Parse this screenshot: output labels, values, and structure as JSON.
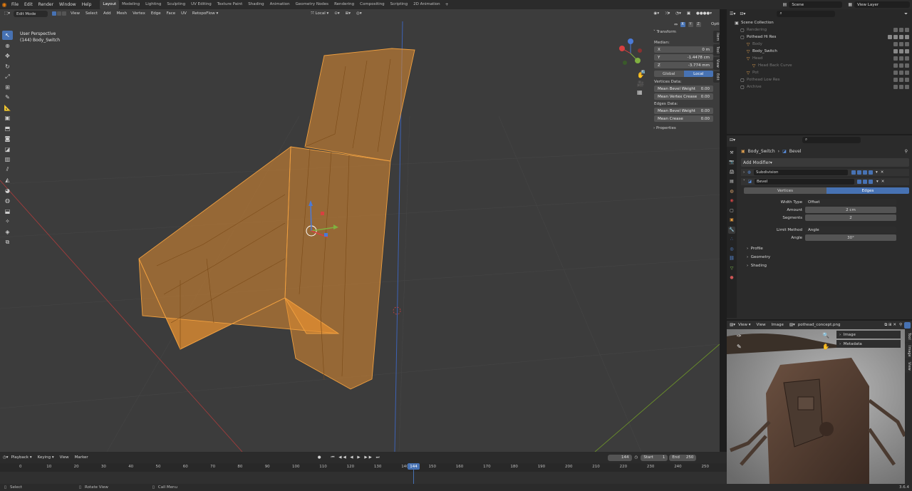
{
  "app": {
    "version": "3.6.4"
  },
  "menu": [
    "File",
    "Edit",
    "Render",
    "Window",
    "Help"
  ],
  "workspaces": [
    {
      "label": "Layout",
      "active": true
    },
    {
      "label": "Modeling"
    },
    {
      "label": "Lighting"
    },
    {
      "label": "Sculpting"
    },
    {
      "label": "UV Editing"
    },
    {
      "label": "Texture Paint"
    },
    {
      "label": "Shading"
    },
    {
      "label": "Animation"
    },
    {
      "label": "Geometry Nodes"
    },
    {
      "label": "Rendering"
    },
    {
      "label": "Compositing"
    },
    {
      "label": "Scripting"
    },
    {
      "label": "2D Animation"
    }
  ],
  "scene": {
    "name": "Scene",
    "view_layer": "View Layer"
  },
  "viewport": {
    "mode": "Edit Mode",
    "menus": [
      "View",
      "Select",
      "Add",
      "Mesh",
      "Vertex",
      "Edge",
      "Face",
      "UV"
    ],
    "addon_menu": "RetopoFlow",
    "orientation": "Local",
    "options": "Options",
    "info_line1": "User Perspective",
    "info_line2": "(144) Body_Switch",
    "gizmo_labels": {
      "x": "X",
      "y": "Y",
      "z": "Z"
    }
  },
  "npanel": {
    "header": "Transform",
    "median": "Median:",
    "coords": [
      {
        "k": "X",
        "v": "0 m"
      },
      {
        "k": "Y",
        "v": "-1.4478 cm"
      },
      {
        "k": "Z",
        "v": "-3.774 mm"
      }
    ],
    "space": [
      {
        "label": "Global"
      },
      {
        "label": "Local",
        "active": true
      }
    ],
    "vertices_data": "Vertices Data:",
    "vert_rows": [
      {
        "k": "Mean Bevel Weight",
        "v": "0.00"
      },
      {
        "k": "Mean Vertex Crease",
        "v": "0.00"
      }
    ],
    "edges_data": "Edges Data:",
    "edge_rows": [
      {
        "k": "Mean Bevel Weight",
        "v": "0.00"
      },
      {
        "k": "Mean Crease",
        "v": "0.00"
      }
    ],
    "properties": "Properties",
    "tabs": [
      "Item",
      "Tool",
      "View",
      "Edit"
    ]
  },
  "outliner": {
    "rows": [
      {
        "label": "Scene Collection",
        "indent": 0,
        "icon": "▣",
        "dim": false
      },
      {
        "label": "Rendering",
        "indent": 1,
        "icon": "▢",
        "dim": true
      },
      {
        "label": "Pothead Hi Res",
        "indent": 1,
        "icon": "▢",
        "dim": false,
        "check": true
      },
      {
        "label": "Body",
        "indent": 2,
        "icon": "▽",
        "dim": true
      },
      {
        "label": "Body_Switch",
        "indent": 2,
        "icon": "▽",
        "dim": false
      },
      {
        "label": "Head",
        "indent": 2,
        "icon": "▽",
        "dim": true
      },
      {
        "label": "Head Back Curve",
        "indent": 3,
        "icon": "▽",
        "dim": true
      },
      {
        "label": "Pot",
        "indent": 2,
        "icon": "▽",
        "dim": true
      },
      {
        "label": "Pothead Low Res",
        "indent": 1,
        "icon": "▢",
        "dim": true
      },
      {
        "label": "Archive",
        "indent": 1,
        "icon": "▢",
        "dim": true
      }
    ]
  },
  "properties": {
    "breadcrumb_obj": "Body_Switch",
    "breadcrumb_mod": "Bevel",
    "add_modifier": "Add Modifier",
    "modifiers": [
      {
        "name": "Subdivision"
      },
      {
        "name": "Bevel"
      }
    ],
    "affect": [
      {
        "label": "Vertices"
      },
      {
        "label": "Edges",
        "active": true
      }
    ],
    "fields": [
      {
        "k": "Width Type",
        "v": "Offset",
        "select": true
      },
      {
        "k": "Amount",
        "v": "2 cm"
      },
      {
        "k": "Segments",
        "v": "2"
      },
      {
        "k": "Limit Method",
        "v": "Angle",
        "select": true
      },
      {
        "k": "Angle",
        "v": "30°"
      }
    ],
    "sections": [
      "Profile",
      "Geometry",
      "Shading"
    ]
  },
  "image_editor": {
    "menus": [
      "View",
      "View",
      "Image"
    ],
    "filename": "pothead_concept.png",
    "panel": [
      "Image",
      "Metadata"
    ],
    "tabs": [
      "Tool",
      "Image",
      "View"
    ]
  },
  "timeline": {
    "menus": [
      "Playback",
      "Keying",
      "View",
      "Marker"
    ],
    "current": "144",
    "start_label": "Start",
    "start": "1",
    "end_label": "End",
    "end": "250",
    "ticks": [
      "0",
      "10",
      "20",
      "30",
      "40",
      "50",
      "60",
      "70",
      "80",
      "90",
      "100",
      "110",
      "120",
      "130",
      "140",
      "150",
      "160",
      "170",
      "180",
      "190",
      "200",
      "210",
      "220",
      "230",
      "240",
      "250"
    ]
  },
  "status": {
    "items": [
      "Select",
      "Rotate View",
      "Call Menu"
    ]
  },
  "colors": {
    "accent": "#4772b3",
    "mesh_orange": "#e8922c",
    "bg_viewport": "#3c3c3c",
    "panel": "#2b2b2b"
  }
}
